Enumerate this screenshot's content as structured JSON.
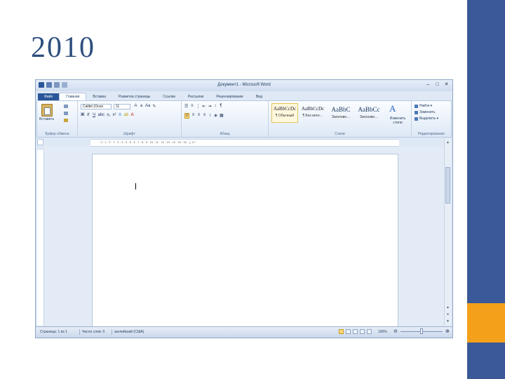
{
  "slide": {
    "title": "2010"
  },
  "window": {
    "title": "Документ1 - Microsoft Word",
    "controls": [
      "–",
      "□",
      "✕"
    ],
    "quick_access": [
      "save-icon",
      "undo-icon",
      "redo-icon"
    ]
  },
  "tabs": [
    "Файл",
    "Главная",
    "Вставка",
    "Разметка страницы",
    "Ссылки",
    "Рассылки",
    "Рецензирование",
    "Вид"
  ],
  "ribbon": {
    "clipboard": {
      "paste": "Вставить",
      "label": "Буфер обмена"
    },
    "font": {
      "name": "Calibri (Осно",
      "size": "11",
      "label": "Шрифт"
    },
    "paragraph": {
      "label": "Абзац"
    },
    "styles": {
      "items": [
        {
          "sample": "AaBbCcDc",
          "name": "¶ Обычный"
        },
        {
          "sample": "AaBbCcDc",
          "name": "¶ Без инте…"
        },
        {
          "sample": "AaBbC",
          "name": "Заголово…"
        },
        {
          "sample": "AaBbCc",
          "name": "Заголово…"
        }
      ],
      "change": "Изменить стили",
      "label": "Стили"
    },
    "editing": {
      "items": [
        "Найти ▾",
        "Заменить",
        "Выделить ▾"
      ],
      "label": "Редактирование"
    }
  },
  "ruler": {
    "numbers": "· 2 · 1 · ▽ · 1 · 2 · 3 · 4 · 5 · 6 · 7 · 8 · 9 · 10 · 11 · 12 · 13 · 14 · 15 · 16 · △ 17 ·"
  },
  "status": {
    "page": "Страница: 1 из 1",
    "words": "Число слов: 0",
    "language": "английский (США)",
    "zoom": "100%"
  },
  "colors": {
    "band": "#3b5998",
    "accent": "#f5a01a",
    "title": "#2e4e7e"
  }
}
